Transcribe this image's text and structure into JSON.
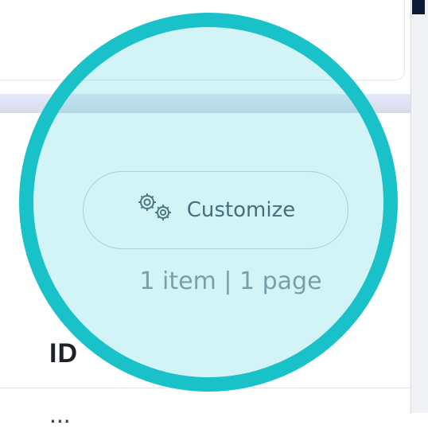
{
  "toolbar": {
    "customize_label": "Customize",
    "pager_text": "1 item | 1 page"
  },
  "table": {
    "header_label": "ID",
    "first_row_value": "..."
  },
  "highlight": {
    "circle_color": "#19c1c8",
    "fill_color": "rgba(55, 205, 220, 0.22)"
  },
  "theme": {
    "top_gradient_start": "#e7e9f8",
    "top_gradient_end": "#d7dae8",
    "button_text": "#4a5660",
    "pager_text": "#8a949c",
    "header_text": "#1f2228",
    "dark_strip": "#0b1a35"
  },
  "icons": {
    "customize_icon": "gears-icon"
  }
}
